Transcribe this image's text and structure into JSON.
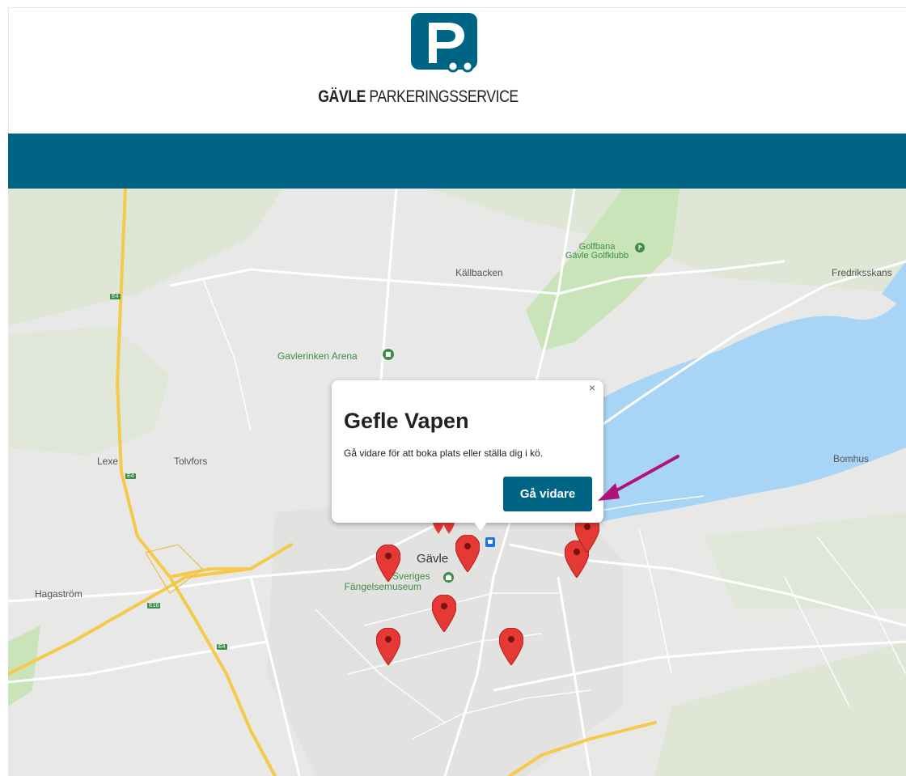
{
  "header": {
    "logo_letter": "P",
    "brand_bold": "GÄVLE",
    "brand_rest": " PARKERINGSSERVICE"
  },
  "colors": {
    "brand": "#006585",
    "marker": "#e53935",
    "water": "#a8d4f5",
    "park": "#c9e4b9",
    "highway": "#f5c94c",
    "annotation_arrow": "#b0127a"
  },
  "map": {
    "labels": {
      "kallbacken": "Källbacken",
      "golfbana": "Golfbana",
      "golfklubb": "Gävle Golfklubb",
      "fredriksskans": "Fredriksskans",
      "gavlerinken": "Gavlerinken Arena",
      "lexe": "Lexe",
      "tolvfors": "Tolvfors",
      "bomhus": "Bomhus",
      "hagastrom": "Hagaström",
      "gavle": "Gävle",
      "sveriges": "Sveriges",
      "fangelsemuseum": "Fängelsemuseum",
      "e4_1": "E4",
      "e4_2": "E4",
      "e4_3": "E4",
      "e16": "E16"
    },
    "markers": [
      "marker",
      "marker",
      "marker",
      "marker",
      "marker",
      "marker",
      "marker",
      "marker",
      "marker"
    ],
    "popup": {
      "title": "Gefle Vapen",
      "text": "Gå vidare för att boka plats eller ställa dig i kö.",
      "close": "×",
      "button": "Gå vidare"
    }
  }
}
